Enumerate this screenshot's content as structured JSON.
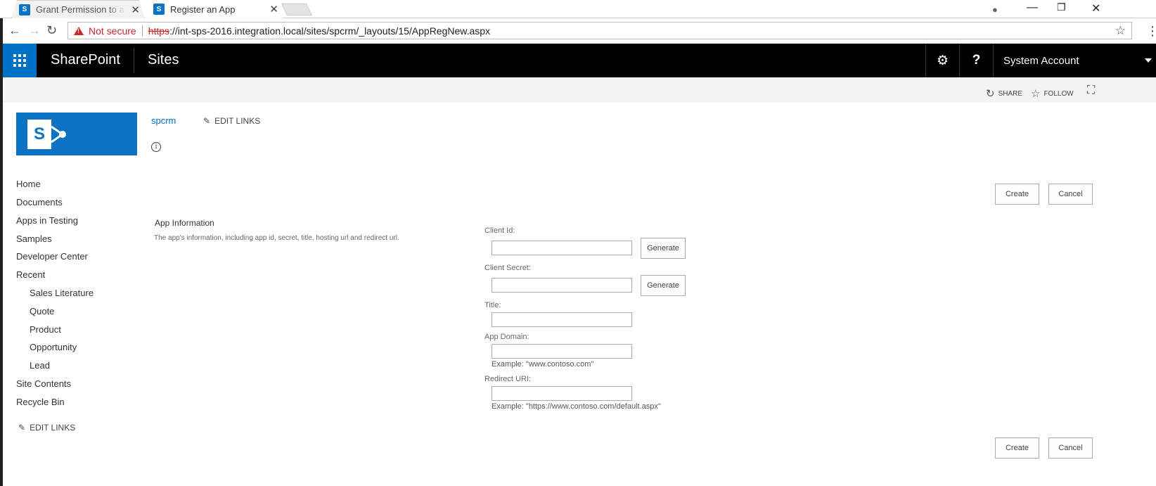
{
  "browser": {
    "tabs": [
      {
        "title": "Grant Permission to an App"
      },
      {
        "title": "Register an App"
      }
    ],
    "address": {
      "security_label": "Not secure",
      "protocol": "https",
      "url_rest": "://int-sps-2016.integration.local/sites/spcrm/_layouts/15/AppRegNew.aspx"
    }
  },
  "suitebar": {
    "brand": "SharePoint",
    "section": "Sites",
    "help_label": "?",
    "account": "System Account"
  },
  "ribbon": {
    "share": "SHARE",
    "follow": "FOLLOW"
  },
  "site": {
    "logo_letter": "S",
    "title": "spcrm",
    "edit_links": "EDIT LINKS"
  },
  "nav": {
    "items": [
      "Home",
      "Documents",
      "Apps in Testing",
      "Samples",
      "Developer Center",
      "Recent"
    ],
    "recent_items": [
      "Sales Literature",
      "Quote",
      "Product",
      "Opportunity",
      "Lead"
    ],
    "bottom_items": [
      "Site Contents",
      "Recycle Bin"
    ],
    "edit_links": "EDIT LINKS"
  },
  "actions": {
    "create": "Create",
    "cancel": "Cancel"
  },
  "form": {
    "section_title": "App Information",
    "section_desc": "The app's information, including app id, secret, title, hosting url and redirect url.",
    "client_id_label": "Client Id:",
    "client_secret_label": "Client Secret:",
    "title_label": "Title:",
    "app_domain_label": "App Domain:",
    "app_domain_hint": "Example: \"www.contoso.com\"",
    "redirect_uri_label": "Redirect URI:",
    "redirect_uri_hint": "Example: \"https://www.contoso.com/default.aspx\"",
    "generate": "Generate",
    "values": {
      "client_id": "",
      "client_secret": "",
      "title": "",
      "app_domain": "",
      "redirect_uri": ""
    }
  }
}
